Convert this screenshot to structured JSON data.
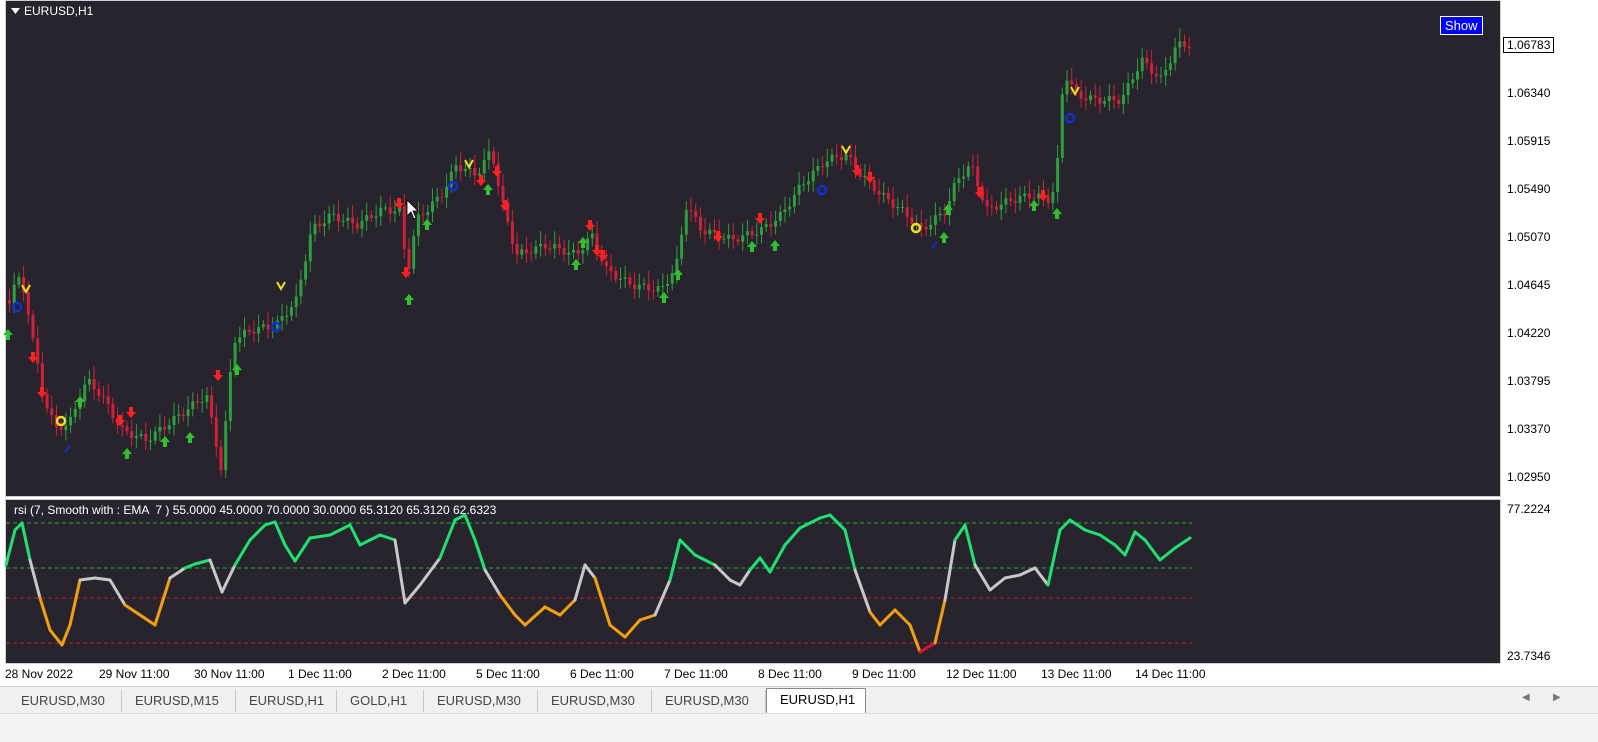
{
  "window": {
    "symbol_title": "EURUSD,H1",
    "show_label": "Show"
  },
  "main_axis": {
    "current_price": "1.06783",
    "price_labels": [
      "1.06340",
      "1.05915",
      "1.05490",
      "1.05070",
      "1.04645",
      "1.04220",
      "1.03795",
      "1.03370",
      "1.02950"
    ]
  },
  "indicator": {
    "label": "rsi (7, Smooth with : EMA  7 ) 55.0000 45.0000 70.0000 30.0000 65.3120 65.3120 62.6323",
    "axis_max": "77.2224",
    "axis_min": "23.7346"
  },
  "time_labels": [
    "28 Nov 2022",
    "29 Nov 11:00",
    "30 Nov 11:00",
    "1 Dec 11:00",
    "2 Dec 11:00",
    "5 Dec 11:00",
    "6 Dec 11:00",
    "7 Dec 11:00",
    "8 Dec 11:00",
    "9 Dec 11:00",
    "12 Dec 11:00",
    "13 Dec 11:00",
    "14 Dec 11:00"
  ],
  "tabs": [
    "EURUSD,M30",
    "EURUSD,M15",
    "EURUSD,H1",
    "GOLD,H1",
    "EURUSD,M30",
    "EURUSD,M30",
    "EURUSD,M30",
    "EURUSD,H1"
  ],
  "active_tab_index": 7,
  "colors": {
    "background": "#28242e",
    "bull_candle": "#2e9e3e",
    "bear_candle": "#d0203a",
    "rsi_strong": "#20e070",
    "rsi_neutral": "#c8c8c8",
    "rsi_weak": "#f0a010",
    "rsi_extreme_low": "#e01030",
    "up_arrow": "#30c030",
    "down_arrow": "#ff2020",
    "marker_blue": "#1030d0",
    "marker_yellow": "#f0e020"
  },
  "icons": {
    "title_menu": "triangle-down-icon",
    "cursor": "mouse-pointer-icon",
    "tab_scroll_left": "chevron-left-icon",
    "tab_scroll_right": "chevron-right-icon"
  }
}
